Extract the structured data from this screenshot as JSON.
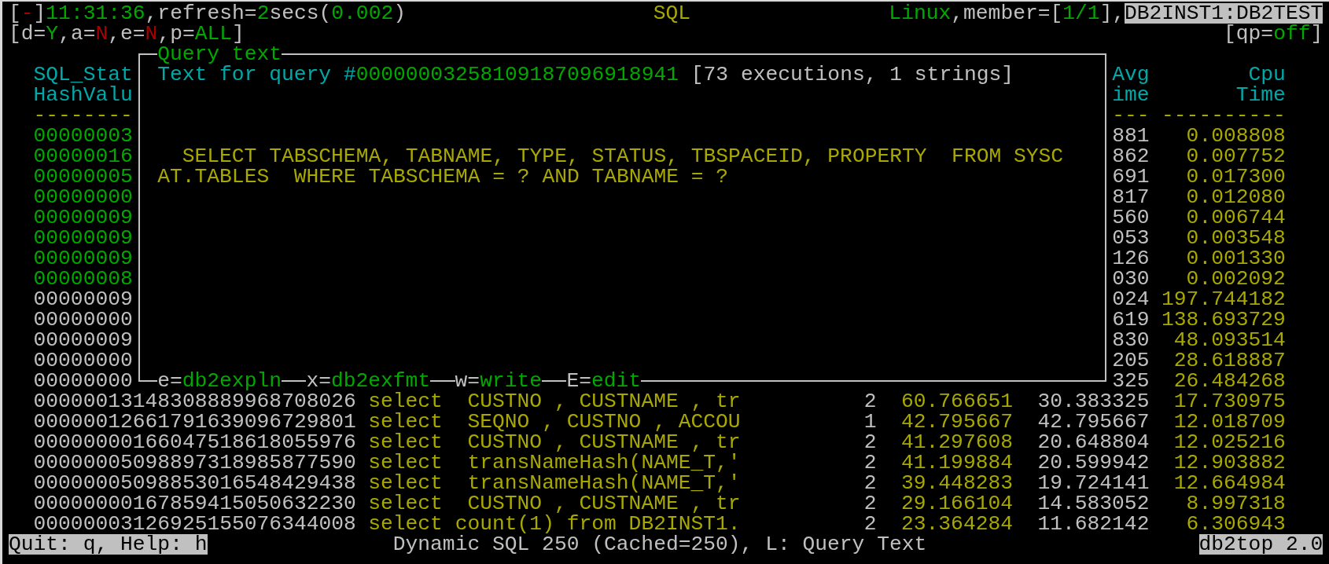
{
  "header": {
    "status": [
      {
        "text": "[",
        "color": "#c0c0c0"
      },
      {
        "text": "-",
        "color": "#a80000"
      },
      {
        "text": "]",
        "color": "#c0c0c0"
      },
      {
        "text": "11:31:36",
        "color": "#00a800"
      },
      {
        "text": ",refresh=",
        "color": "#c0c0c0"
      },
      {
        "text": "2",
        "color": "#00a800"
      },
      {
        "text": "secs(",
        "color": "#c0c0c0"
      },
      {
        "text": "0.002",
        "color": "#00a800"
      },
      {
        "text": ")",
        "color": "#c0c0c0"
      }
    ],
    "title": "SQL",
    "host": [
      {
        "text": "Linux",
        "color": "#00a800"
      },
      {
        "text": ",member=[",
        "color": "#c0c0c0"
      },
      {
        "text": "1/1",
        "color": "#00a800"
      },
      {
        "text": "],",
        "color": "#c0c0c0"
      }
    ],
    "instance": "DB2INST1:DB2TEST",
    "filters": [
      {
        "text": "[d=",
        "color": "#c0c0c0"
      },
      {
        "text": "Y",
        "color": "#00a800"
      },
      {
        "text": ",a=",
        "color": "#c0c0c0"
      },
      {
        "text": "N",
        "color": "#a80000"
      },
      {
        "text": ",e=",
        "color": "#c0c0c0"
      },
      {
        "text": "N",
        "color": "#a80000"
      },
      {
        "text": ",p=",
        "color": "#c0c0c0"
      },
      {
        "text": "ALL",
        "color": "#00a800"
      },
      {
        "text": "]",
        "color": "#c0c0c0"
      }
    ],
    "qp": [
      {
        "text": "[qp=",
        "color": "#c0c0c0"
      },
      {
        "text": "off",
        "color": "#00a800"
      },
      {
        "text": "]",
        "color": "#c0c0c0"
      }
    ]
  },
  "columns": [
    {
      "lines": [
        "SQL_Stat",
        "HashValu"
      ],
      "rule": "--------"
    },
    {
      "lines": [
        "Avg",
        "ime"
      ],
      "rule": "---"
    },
    {
      "lines": [
        "Cpu",
        "Time"
      ],
      "rule": "----------"
    }
  ],
  "rows": [
    {
      "kind": "partial",
      "hash": "00000003",
      "color": "#00a800",
      "avg_time": "881",
      "cpu_time": "0.008808"
    },
    {
      "kind": "partial",
      "hash": "00000016",
      "color": "#00a800",
      "avg_time": "862",
      "cpu_time": "0.007752"
    },
    {
      "kind": "partial",
      "hash": "00000005",
      "color": "#00a800",
      "avg_time": "691",
      "cpu_time": "0.017300"
    },
    {
      "kind": "partial",
      "hash": "00000000",
      "color": "#00a800",
      "avg_time": "817",
      "cpu_time": "0.012080"
    },
    {
      "kind": "partial",
      "hash": "00000009",
      "color": "#00a800",
      "avg_time": "560",
      "cpu_time": "0.006744"
    },
    {
      "kind": "partial",
      "hash": "00000009",
      "color": "#00a800",
      "avg_time": "053",
      "cpu_time": "0.003548"
    },
    {
      "kind": "partial",
      "hash": "00000009",
      "color": "#00a800",
      "avg_time": "126",
      "cpu_time": "0.001330"
    },
    {
      "kind": "partial",
      "hash": "00000008",
      "color": "#00a800",
      "avg_time": "030",
      "cpu_time": "0.002092"
    },
    {
      "kind": "partial",
      "hash": "00000009",
      "color": "#c0c0c0",
      "avg_time": "024",
      "cpu_time": "197.744182"
    },
    {
      "kind": "partial",
      "hash": "00000000",
      "color": "#c0c0c0",
      "avg_time": "619",
      "cpu_time": "138.693729"
    },
    {
      "kind": "partial",
      "hash": "00000009",
      "color": "#c0c0c0",
      "avg_time": "830",
      "cpu_time": "48.093514"
    },
    {
      "kind": "partial",
      "hash": "00000000",
      "color": "#c0c0c0",
      "avg_time": "205",
      "cpu_time": "28.618887"
    },
    {
      "kind": "partial",
      "hash": "00000000",
      "color": "#c0c0c0",
      "avg_time": "325",
      "cpu_time": "26.484268"
    },
    {
      "kind": "full",
      "hash": "00000013148308889968708026",
      "color": "#c0c0c0",
      "statement": "select  CUSTNO , CUSTNAME , tr",
      "executions": "2",
      "column_4": "60.766651",
      "avg_time": "30.383325",
      "cpu_time": "17.730975"
    },
    {
      "kind": "full",
      "hash": "00000012661791639096729801",
      "color": "#c0c0c0",
      "statement": "select  SEQNO , CUSTNO , ACCOU",
      "executions": "1",
      "column_4": "42.795667",
      "avg_time": "42.795667",
      "cpu_time": "12.018709"
    },
    {
      "kind": "full",
      "hash": "00000000166047518618055976",
      "color": "#c0c0c0",
      "statement": "select  CUSTNO , CUSTNAME , tr",
      "executions": "2",
      "column_4": "41.297608",
      "avg_time": "20.648804",
      "cpu_time": "12.025216"
    },
    {
      "kind": "full",
      "hash": "00000005098897318985877590",
      "color": "#c0c0c0",
      "statement": "select  transNameHash(NAME_T,'",
      "executions": "2",
      "column_4": "41.199884",
      "avg_time": "20.599942",
      "cpu_time": "12.903882"
    },
    {
      "kind": "full",
      "hash": "00000005098853016548429438",
      "color": "#c0c0c0",
      "statement": "select  transNameHash(NAME_T,'",
      "executions": "2",
      "column_4": "39.448283",
      "avg_time": "19.724141",
      "cpu_time": "12.664984"
    },
    {
      "kind": "full",
      "hash": "00000000167859415050632230",
      "color": "#c0c0c0",
      "statement": "select  CUSTNO , CUSTNAME , tr",
      "executions": "2",
      "column_4": "29.166104",
      "avg_time": "14.583052",
      "cpu_time": "8.997318"
    },
    {
      "kind": "full",
      "hash": "00000003126925155076344008",
      "color": "#c0c0c0",
      "statement": "select count(1) from DB2INST1.",
      "executions": "2",
      "column_4": "23.364284",
      "avg_time": "11.682142",
      "cpu_time": "6.306943"
    }
  ],
  "dialog": {
    "title": "Query text",
    "heading": [
      {
        "text": "Text for query #",
        "color": "#00a8a8"
      },
      {
        "text": "00000003258109187096918941",
        "color": "#00a800"
      },
      {
        "text": " [73 executions, 1 strings]",
        "color": "#c0c0c0"
      }
    ],
    "query_lines": [
      "SELECT TABSCHEMA, TABNAME, TYPE, STATUS, TBSPACEID, PROPERTY  FROM SYSC",
      "AT.TABLES  WHERE TABSCHEMA = ? AND TABNAME = ?"
    ],
    "actions": [
      {
        "key": "e=",
        "command": "db2expln"
      },
      {
        "key": "x=",
        "command": "db2exfmt"
      },
      {
        "key": "w=",
        "command": "write"
      },
      {
        "key": "E=",
        "command": "edit"
      }
    ]
  },
  "status_bar": {
    "help": "Quit: q, Help: h",
    "message": "Dynamic SQL 250 (Cached=250), L: Query Text",
    "version": "db2top 2.0"
  }
}
